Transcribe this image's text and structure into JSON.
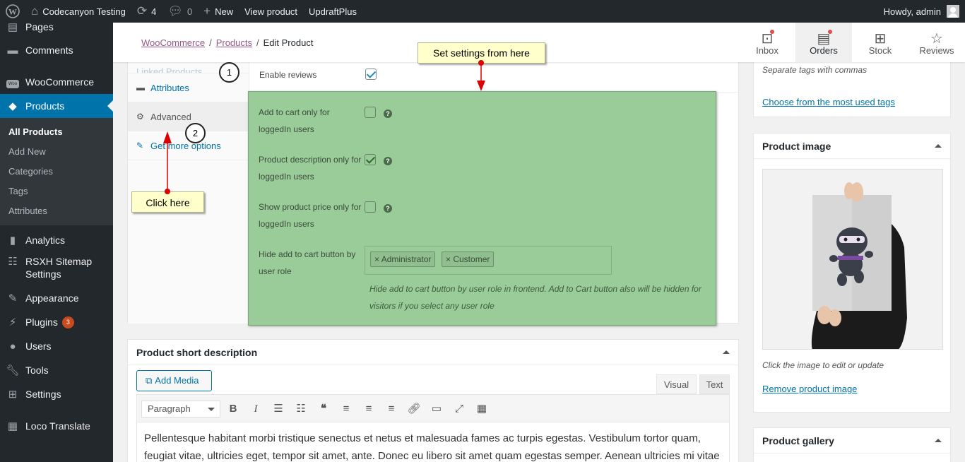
{
  "adminbar": {
    "site_name": "Codecanyon Testing",
    "updates_count": "4",
    "comments_count": "0",
    "new_label": "New",
    "view_product": "View product",
    "updraft": "UpdraftPlus",
    "howdy": "Howdy, admin"
  },
  "sidebar": {
    "pages": "Pages",
    "comments": "Comments",
    "woocommerce": "WooCommerce",
    "woo_icon_text": "Woo",
    "products": "Products",
    "submenu": [
      "All Products",
      "Add New",
      "Categories",
      "Tags",
      "Attributes"
    ],
    "analytics": "Analytics",
    "rsxh_line1": "RSXH Sitemap",
    "rsxh_line2": "Settings",
    "appearance": "Appearance",
    "plugins": "Plugins",
    "plugins_badge": "3",
    "users": "Users",
    "tools": "Tools",
    "settings": "Settings",
    "loco": "Loco Translate"
  },
  "header": {
    "crumb1": "WooCommerce",
    "crumb2": "Products",
    "crumb3": "Edit Product",
    "tabs": [
      "Inbox",
      "Orders",
      "Stock",
      "Reviews"
    ]
  },
  "product_data": {
    "tabs": [
      "Linked Products",
      "Attributes",
      "Advanced",
      "Get more options"
    ],
    "enable_reviews": "Enable reviews"
  },
  "advanced_panel": {
    "rows": [
      {
        "label": "Add to cart only for loggedIn users",
        "checked": false
      },
      {
        "label": "Product description only for loggedIn users",
        "checked": true
      },
      {
        "label": "Show product price only for loggedIn users",
        "checked": false
      },
      {
        "label": "Hide add to cart button by user role"
      }
    ],
    "roles": [
      "Administrator",
      "Customer"
    ],
    "description": "Hide add to cart button by user role in frontend. Add to Cart button also will be hidden for visitors if you select any user role"
  },
  "callouts": {
    "top": "Set settings from here",
    "bottom": "Click here",
    "step1": "1",
    "step2": "2"
  },
  "tags_box": {
    "hint": "Separate tags with commas",
    "choose_link": "Choose from the most used tags"
  },
  "product_image": {
    "title": "Product image",
    "hint": "Click the image to edit or update",
    "remove": "Remove product image"
  },
  "gallery": {
    "title": "Product gallery"
  },
  "short_desc": {
    "title": "Product short description",
    "add_media": "Add Media",
    "visual": "Visual",
    "text": "Text",
    "format": "Paragraph",
    "content": "Pellentesque habitant morbi tristique senectus et netus et malesuada fames ac turpis egestas. Vestibulum tortor quam, feugiat vitae, ultricies eget, tempor sit amet, ante. Donec eu libero sit amet quam egestas semper. Aenean ultricies mi vitae est."
  },
  "colors": {
    "admin_dark": "#23282d",
    "active_blue": "#0073aa",
    "panel_green": "#99cc99",
    "callout_yellow": "#ffffcc",
    "arrow_red": "#e00000"
  }
}
